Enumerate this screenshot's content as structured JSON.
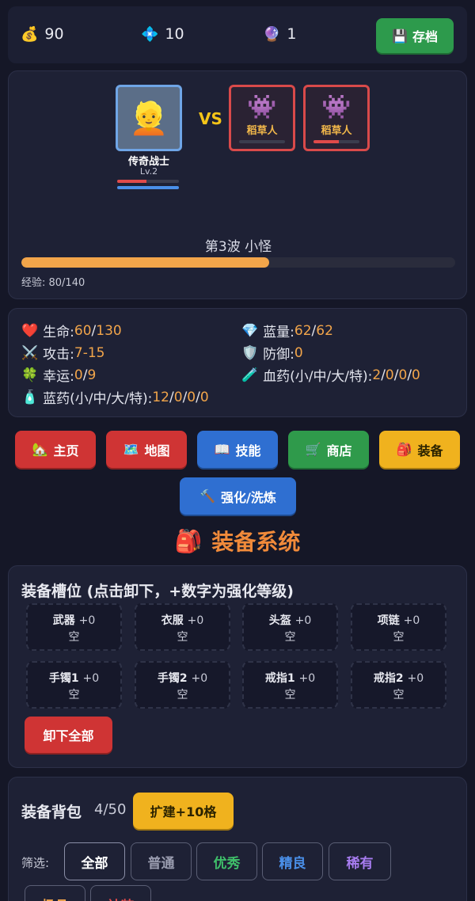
{
  "topbar": {
    "gold": {
      "icon": "💰",
      "value": "90"
    },
    "gems": {
      "icon": "💠",
      "value": "10"
    },
    "orbs": {
      "icon": "🔮",
      "value": "1"
    },
    "save_label": "存档"
  },
  "battle": {
    "hero": {
      "name": "传奇战士",
      "level": "Lv.2",
      "hp_fraction": 0.48,
      "mp_fraction": 1.0
    },
    "vs": "VS",
    "enemies": [
      {
        "name": "稻草人",
        "hp_fraction": 0.0
      },
      {
        "name": "稻草人",
        "hp_fraction": 0.55
      }
    ],
    "wave": "第3波 小怪",
    "exp_label": "经验: 80/140",
    "exp_fraction": 0.571
  },
  "stats": {
    "hp": {
      "label": "生命: ",
      "cur": "60",
      "max": "130"
    },
    "attack": {
      "label": "攻击: ",
      "value": "7-15"
    },
    "luck": {
      "label": "幸运: ",
      "cur": "0",
      "max": "9"
    },
    "mp_potion": {
      "label": "蓝药(小/中/大/特): ",
      "v1": "12",
      "v2": "0",
      "v3": "0",
      "v4": "0"
    },
    "mp": {
      "label": "蓝量: ",
      "cur": "62",
      "max": "62"
    },
    "defense": {
      "label": "防御: ",
      "value": "0"
    },
    "hp_potion": {
      "label": "血药(小/中/大/特): ",
      "v1": "2",
      "v2": "0",
      "v3": "0",
      "v4": "0"
    }
  },
  "nav": {
    "home": "主页",
    "map": "地图",
    "skills": "技能",
    "shop": "商店",
    "equip": "装备",
    "enhance": "强化/洗炼"
  },
  "section_title": "装备系统",
  "slots": {
    "title": "装备槽位 (点击卸下，+数字为强化等级)",
    "items": [
      {
        "name": "武器",
        "level": "+0",
        "state": "空"
      },
      {
        "name": "衣服",
        "level": "+0",
        "state": "空"
      },
      {
        "name": "头盔",
        "level": "+0",
        "state": "空"
      },
      {
        "name": "项链",
        "level": "+0",
        "state": "空"
      },
      {
        "name": "手镯1",
        "level": "+0",
        "state": "空"
      },
      {
        "name": "手镯2",
        "level": "+0",
        "state": "空"
      },
      {
        "name": "戒指1",
        "level": "+0",
        "state": "空"
      },
      {
        "name": "戒指2",
        "level": "+0",
        "state": "空"
      }
    ],
    "unequip_all": "卸下全部"
  },
  "bag": {
    "title": "装备背包",
    "count": "4/50",
    "expand": "扩建+10格",
    "filter_label": "筛选:",
    "filters": [
      "全部",
      "普通",
      "优秀",
      "精良",
      "稀有",
      "极品",
      "神装"
    ]
  },
  "colors": {
    "accent_orange": "#f2a54a",
    "rarity_excellent": "#3fbf6a",
    "rarity_fine": "#4a8fe8",
    "rarity_rare": "#a77cf0",
    "rarity_epic": "#f2a54a",
    "rarity_legend": "#e04a4a"
  }
}
